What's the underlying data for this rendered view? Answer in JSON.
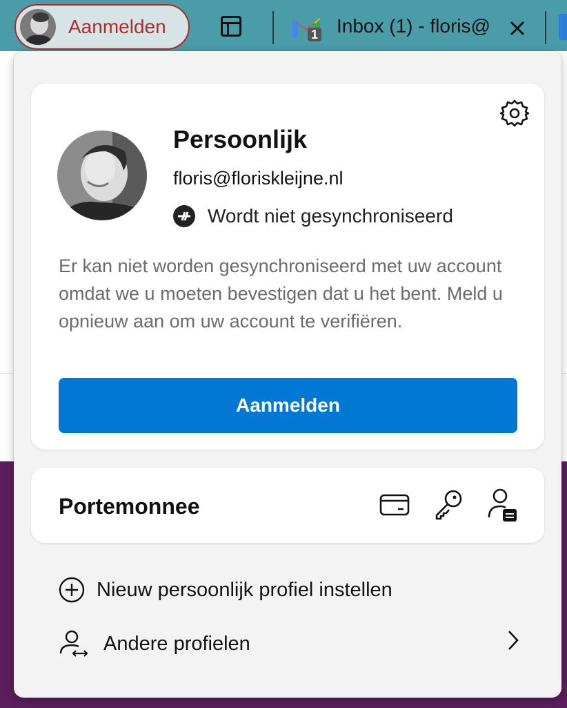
{
  "toolbar": {
    "profile_button_label": "Aanmelden",
    "tab_title": "Inbox (1) - floris@",
    "gmail_badge": "1"
  },
  "popup": {
    "profile": {
      "name": "Persoonlijk",
      "email": "floris@floriskleijne.nl",
      "sync_status": "Wordt niet gesynchroniseerd",
      "message": "Er kan niet worden gesynchroniseerd met uw account omdat we u moeten bevestigen dat u het bent. Meld u opnieuw aan om uw account te verifiëren.",
      "signin_button": "Aanmelden"
    },
    "wallet": {
      "title": "Portemonnee",
      "icons": [
        "credit-card-icon",
        "key-icon",
        "person-card-icon"
      ]
    },
    "actions": {
      "new_profile": "Nieuw persoonlijk profiel instellen",
      "other_profiles": "Andere profielen"
    }
  },
  "colors": {
    "accent": "#0078d4",
    "signin_outline": "#b02a2a",
    "toolbar_bg": "#4a9ca8"
  }
}
